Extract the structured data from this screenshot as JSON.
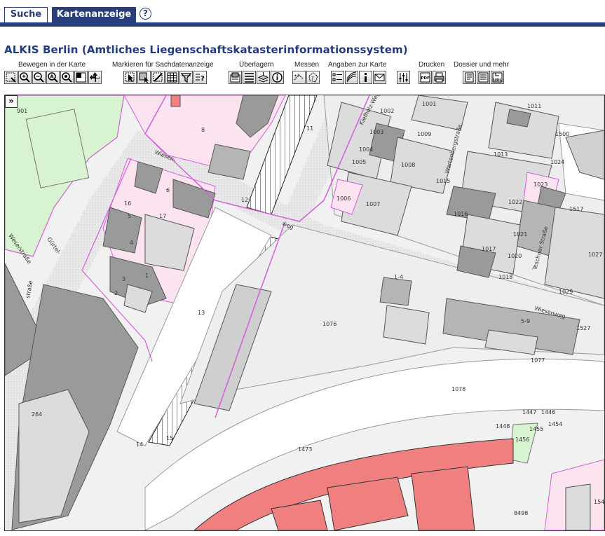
{
  "tabs": [
    {
      "label": "Suche",
      "active": false
    },
    {
      "label": "Kartenanzeige",
      "active": true
    }
  ],
  "help_label": "?",
  "page_title": "ALKIS Berlin (Amtliches Liegenschaftskatasterinformationssystem)",
  "toolbar": {
    "groups": [
      {
        "label": "Bewegen in der Karte",
        "icons": [
          "zoom-box-icon",
          "zoom-in-icon",
          "zoom-out-icon",
          "zoom-all-icon",
          "zoom-previous-icon",
          "overview-icon",
          "pan-icon"
        ]
      },
      {
        "label": "Markieren für Sachdatenanzeige",
        "icons": [
          "select-point-icon",
          "select-rect-icon",
          "clear-selection-icon",
          "table-icon",
          "filter-icon",
          "query-icon"
        ]
      },
      {
        "label": "Überlagern",
        "icons": [
          "overlay-add-icon",
          "overlay-list-icon",
          "layers-icon",
          "info-icon"
        ]
      },
      {
        "label": "Messen",
        "icons": [
          "measure-distance-icon",
          "measure-area-icon"
        ]
      },
      {
        "label": "Angaben zur Karte",
        "icons": [
          "legend-icon",
          "scale-icon",
          "map-info-icon",
          "mail-icon",
          "settings-icon"
        ]
      },
      {
        "label": "Drucken",
        "icons": [
          "pdf-icon",
          "print-icon"
        ]
      },
      {
        "label": "Dossier und mehr",
        "icons": [
          "dossier-icon",
          "report-icon",
          "url-icon"
        ]
      }
    ]
  },
  "map": {
    "expand_label": "»",
    "colors": {
      "background": "#f2f2f2",
      "building_light": "#dcdcdc",
      "building_dark": "#9a9a9a",
      "parcel_pink": "#fbe4f0",
      "green": "#d8f3d0",
      "highlight": "#f08080",
      "boundary": "#d35fd8"
    },
    "labels": {
      "parcels": [
        "901",
        "8",
        "11",
        "1002",
        "1001",
        "1011",
        "1003",
        "1009",
        "1500",
        "1004",
        "1005",
        "1008",
        "1013",
        "1024",
        "1006",
        "1007",
        "1015",
        "1023",
        "1016",
        "1022",
        "1517",
        "1017",
        "1021",
        "1020",
        "1027",
        "1018",
        "1029",
        "1527",
        "1076",
        "1077",
        "1078",
        "1473",
        "1447",
        "1446",
        "1448",
        "1455",
        "1454",
        "1456",
        "264",
        "13",
        "14",
        "15",
        "12",
        "6",
        "17",
        "16",
        "5",
        "4",
        "3",
        "2",
        "1",
        "8498",
        "154"
      ],
      "streets": [
        "Wiesen-",
        "weg",
        "Weserstraße",
        "Gürtel-",
        "straße",
        "Kiefholz-Weg",
        "Wartenbergstraße",
        "Teschner Straße",
        "Wiesenweg"
      ],
      "misc": [
        "5-9",
        "1-4"
      ]
    }
  }
}
